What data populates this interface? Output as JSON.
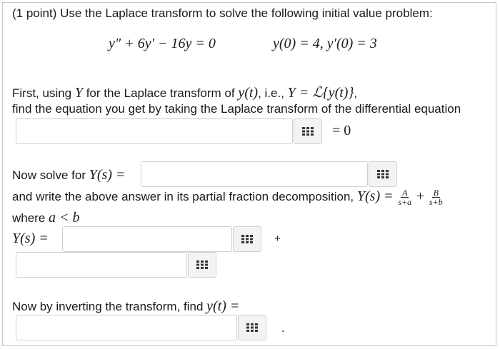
{
  "problem": {
    "intro": "(1 point) Use the Laplace transform to solve the following initial value problem:",
    "equation": "y″ + 6y′ − 16y = 0",
    "initial_conditions": "y(0) = 4,  y′(0) = 3"
  },
  "step1": {
    "line1_a": "First, using ",
    "line1_Y": "Y",
    "line1_b": " for the Laplace transform of ",
    "line1_yt": "y(t)",
    "line1_c": ", i.e., ",
    "line1_def": "Y = ℒ{y(t)}",
    "line1_d": ",",
    "line2": "find the equation you get by taking the Laplace transform of the differential equation",
    "equals_zero": "= 0"
  },
  "step2": {
    "label_a": "Now solve for ",
    "label_Ys": "Y(s) ="
  },
  "step3": {
    "text": "and write the above answer in its partial fraction decomposition, ",
    "Ys": "Y(s) =",
    "frac1_num": "A",
    "frac1_den": "s+a",
    "plus": "+",
    "frac2_num": "B",
    "frac2_den": "s+b",
    "where_a": "where ",
    "where_math": "a < b",
    "Ys_label": "Y(s) =",
    "plus_after": "+"
  },
  "step4": {
    "text": "Now by inverting the transform, find ",
    "yt": "y(t) =",
    "period": "."
  },
  "icons": {
    "math_editor": "grid-icon"
  }
}
